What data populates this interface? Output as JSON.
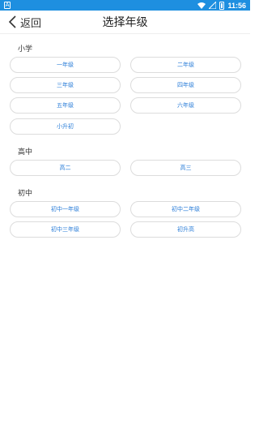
{
  "status_bar": {
    "time": "11:56"
  },
  "header": {
    "back_label": "返回",
    "title": "选择年级"
  },
  "sections": [
    {
      "title": "小学",
      "items": [
        "一年级",
        "二年级",
        "三年级",
        "四年级",
        "五年级",
        "六年级",
        "小升初"
      ]
    },
    {
      "title": "高中",
      "items": [
        "高二",
        "高三"
      ]
    },
    {
      "title": "初中",
      "items": [
        "初中一年级",
        "初中二年级",
        "初中三年级",
        "初升高"
      ]
    }
  ]
}
